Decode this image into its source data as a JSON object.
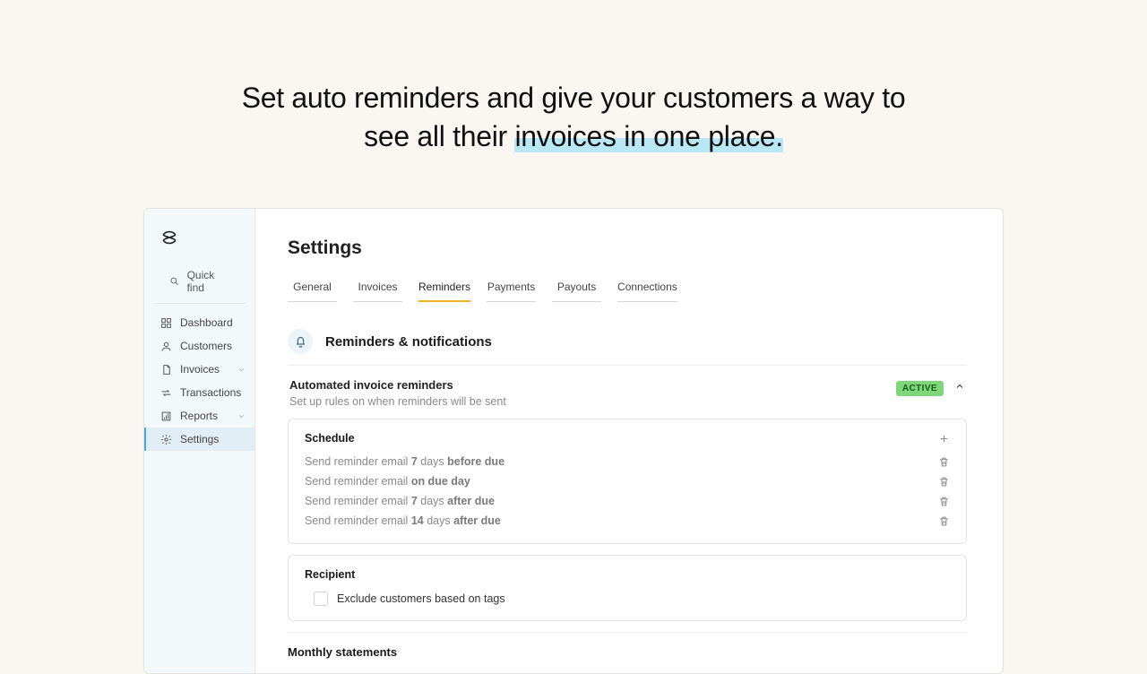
{
  "hero": {
    "line1": "Set auto reminders and give your customers a way to",
    "line2_pre": "see all their ",
    "line2_hl": "invoices in one place."
  },
  "sidebar": {
    "quickfind": "Quick find",
    "items": [
      {
        "label": "Dashboard"
      },
      {
        "label": "Customers"
      },
      {
        "label": "Invoices",
        "expandable": true
      },
      {
        "label": "Transactions"
      },
      {
        "label": "Reports",
        "expandable": true
      },
      {
        "label": "Settings",
        "active": true
      }
    ]
  },
  "page": {
    "title": "Settings",
    "tabs": [
      "General",
      "Invoices",
      "Reminders",
      "Payments",
      "Payouts",
      "Connections"
    ],
    "active_tab_index": 2
  },
  "section": {
    "title": "Reminders & notifications"
  },
  "auto_reminders": {
    "title": "Automated invoice reminders",
    "subtitle": "Set up rules on when reminders will be sent",
    "badge": "ACTIVE"
  },
  "schedule": {
    "title": "Schedule",
    "prefix": "Send reminder email ",
    "rules": [
      {
        "n": "7",
        "unit": " days ",
        "rel": "before due"
      },
      {
        "n": "",
        "unit": "",
        "rel": "on due day"
      },
      {
        "n": "7",
        "unit": " days ",
        "rel": "after due"
      },
      {
        "n": "14",
        "unit": " days ",
        "rel": "after due"
      }
    ]
  },
  "recipient": {
    "title": "Recipient",
    "exclude_label": "Exclude customers based on tags"
  },
  "monthly": {
    "title": "Monthly statements"
  }
}
